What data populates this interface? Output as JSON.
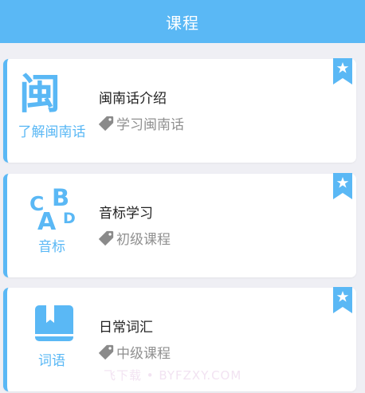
{
  "header": {
    "title": "课程"
  },
  "courses": [
    {
      "icon_name": "min-character-icon",
      "icon_glyph": "闽",
      "left_label": "了解闽南话",
      "title": "闽南话介绍",
      "tag": "学习闽南话"
    },
    {
      "icon_name": "abcd-letters-icon",
      "left_label": "音标",
      "title": "音标学习",
      "tag": "初级课程"
    },
    {
      "icon_name": "book-icon",
      "left_label": "词语",
      "title": "日常词汇",
      "tag": "中级课程"
    }
  ],
  "icons": {
    "bookmark": "bookmark-star-icon",
    "tag": "tag-icon"
  },
  "watermark": "飞下载 • BYFZXY.COM",
  "colors": {
    "accent": "#5ab8f5",
    "background": "#efeff4",
    "card": "#ffffff",
    "title_text": "#222222",
    "tag_text": "#909090"
  }
}
